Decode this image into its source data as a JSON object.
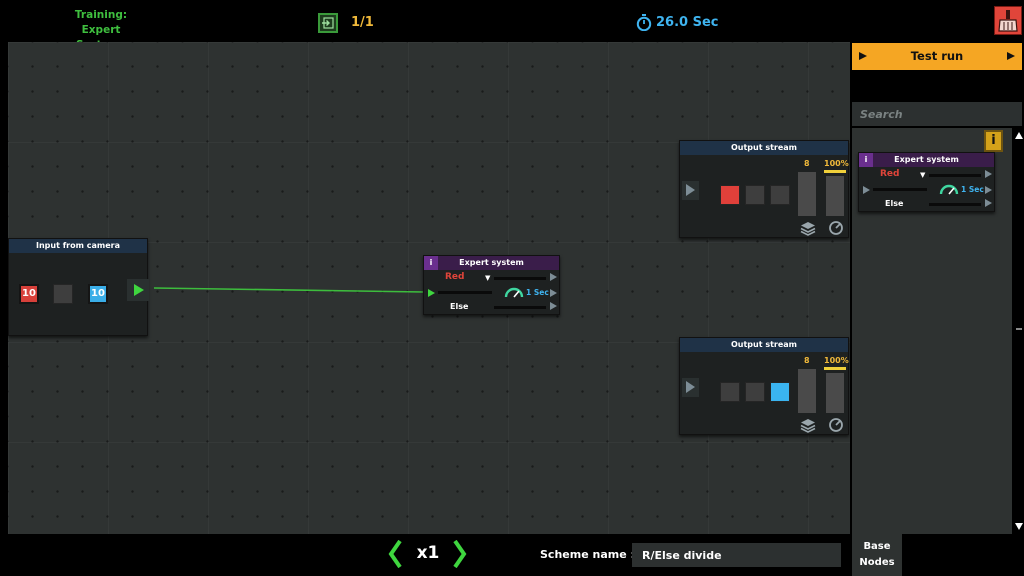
{
  "header": {
    "level_title_line1": "Training: Expert",
    "level_title_line2": "Systems",
    "level_count": "1/1",
    "timer": "26.0 Sec"
  },
  "canvas": {
    "camera_node": {
      "title": "Input from camera",
      "slots": [
        "10",
        "",
        "10"
      ]
    },
    "expert_node": {
      "title": "Expert system",
      "info": "i",
      "condition": "Red",
      "dropdown_arrow": "▼",
      "else_label": "Else",
      "duration": "1 Sec"
    },
    "output_top": {
      "title": "Output stream",
      "count": "8",
      "percent": "100%"
    },
    "output_bottom": {
      "title": "Output stream",
      "count": "8",
      "percent": "100%"
    }
  },
  "sidebar": {
    "test_run_label": "Test run",
    "search_placeholder": "Search",
    "info_icon_label": "i",
    "palette_node": {
      "title": "Expert system",
      "info": "i",
      "condition": "Red",
      "dropdown_arrow": "▼",
      "else_label": "Else",
      "duration": "1 Sec"
    }
  },
  "footer": {
    "speed": "x1",
    "scheme_label": "Scheme name :",
    "scheme_value": "R/Else divide",
    "base_nodes_line1": "Base",
    "base_nodes_line2": "Nodes"
  },
  "colors": {
    "accent_orange": "#f5a623",
    "wire_green": "#3fd63f",
    "timer_blue": "#3fb4f0",
    "title_green": "#3fbf3f",
    "value_yellow": "#f0b93a",
    "red_item": "#e0403a",
    "blue_item": "#3ab4f0"
  }
}
